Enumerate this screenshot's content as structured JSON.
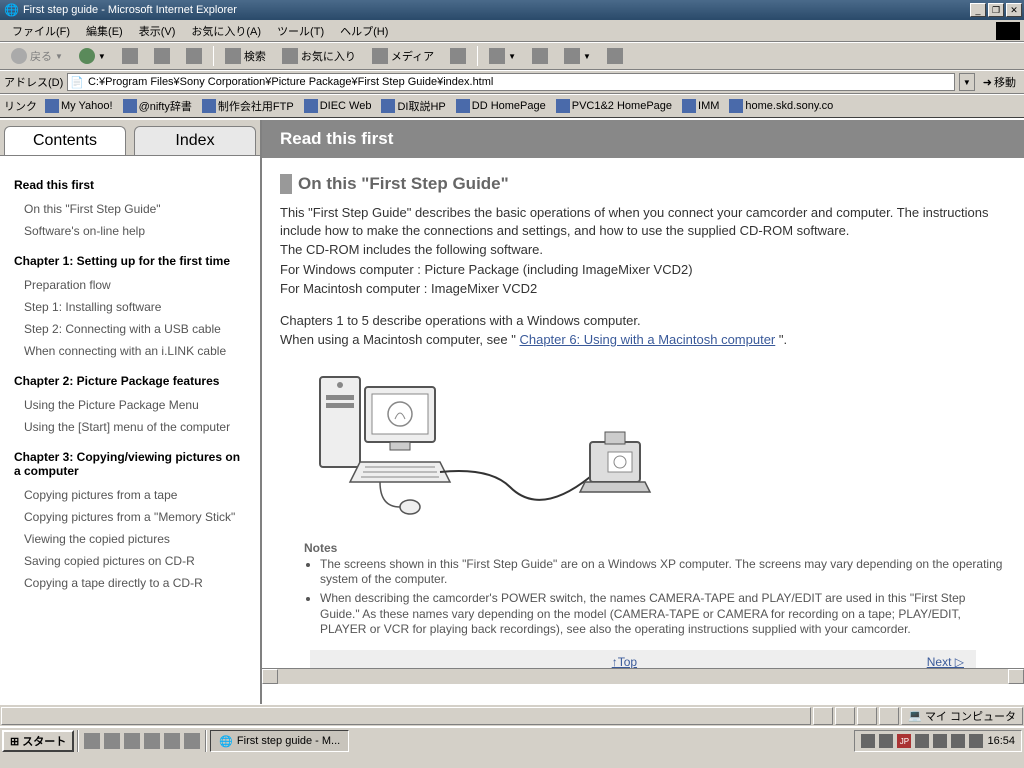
{
  "window": {
    "title": "First step guide - Microsoft Internet Explorer"
  },
  "menubar": {
    "file": "ファイル(F)",
    "edit": "編集(E)",
    "view": "表示(V)",
    "favorites": "お気に入り(A)",
    "tools": "ツール(T)",
    "help": "ヘルプ(H)"
  },
  "toolbar": {
    "back": "戻る",
    "search": "検索",
    "favorites": "お気に入り",
    "media": "メディア"
  },
  "address": {
    "label": "アドレス(D)",
    "value": "C:¥Program Files¥Sony Corporation¥Picture Package¥First Step Guide¥index.html",
    "go": "移動"
  },
  "links": {
    "label": "リンク",
    "items": [
      "My Yahoo!",
      "@nifty辞書",
      "制作会社用FTP",
      "DIEC Web",
      "DI取説HP",
      "DD HomePage",
      "PVC1&2 HomePage",
      "IMM",
      "home.skd.sony.co"
    ]
  },
  "sidebar": {
    "tabs": {
      "contents": "Contents",
      "index": "Index"
    },
    "sections": [
      {
        "title": "Read this first",
        "items": [
          "On this \"First Step Guide\"",
          "Software's on-line help"
        ]
      },
      {
        "title": "Chapter 1: Setting up for the first time",
        "items": [
          "Preparation flow",
          "Step 1: Installing software",
          "Step 2: Connecting with a USB cable",
          "When connecting with an i.LINK cable"
        ]
      },
      {
        "title": "Chapter 2: Picture Package features",
        "items": [
          "Using the Picture Package Menu",
          "Using the [Start] menu of the computer"
        ]
      },
      {
        "title": "Chapter 3: Copying/viewing pictures on a computer",
        "items": [
          "Copying pictures from a tape",
          "Copying pictures from a \"Memory Stick\"",
          "Viewing the copied pictures",
          "Saving copied pictures on CD-R",
          "Copying a tape directly to a CD-R"
        ]
      }
    ]
  },
  "main": {
    "header": "Read this first",
    "section_title": "On this \"First Step Guide\"",
    "p1": "This \"First Step Guide\" describes the basic operations of when you connect your camcorder and computer. The instructions include how to make the connections and settings, and how to use the supplied CD-ROM software.",
    "p2": "The CD-ROM includes the following software.",
    "p3": "For Windows computer : Picture Package (including ImageMixer VCD2)",
    "p4": "For Macintosh computer : ImageMixer VCD2",
    "p5": "Chapters 1 to 5 describe operations with a Windows computer.",
    "p6a": "When using a Macintosh computer, see \" ",
    "p6link": "Chapter 6: Using with a Macintosh computer",
    "p6b": " \".",
    "notes_label": "Notes",
    "notes": [
      "The screens shown in this \"First Step Guide\" are on a Windows XP computer. The screens may vary depending on the operating system of the computer.",
      "When describing the camcorder's POWER switch, the names CAMERA-TAPE and PLAY/EDIT are used in this \"First Step Guide.\" As these names vary depending on the model (CAMERA-TAPE or CAMERA for recording on a tape; PLAY/EDIT, PLAYER or VCR for playing back recordings), see also the operating instructions supplied with your camcorder."
    ],
    "top": "↑Top",
    "next": "Next ▷"
  },
  "status": {
    "mycomputer": "マイ コンピュータ"
  },
  "taskbar": {
    "start": "スタート",
    "task": "First step guide - M...",
    "ime": "JP",
    "clock": "16:54"
  }
}
